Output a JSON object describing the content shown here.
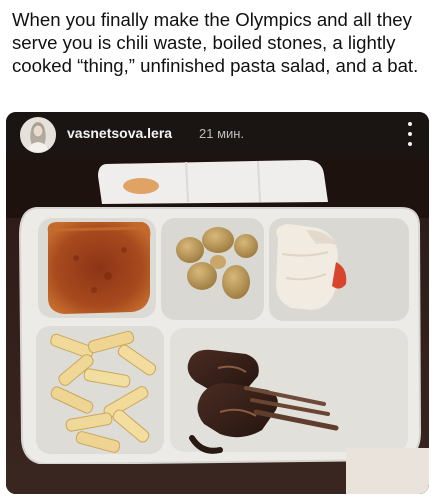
{
  "caption": {
    "text": "When you finally make the Olympics and all they serve you is chili waste, boiled stones, a lightly cooked “thing,” unfinished pasta salad, and a bat."
  },
  "post": {
    "username": "vasnetsova.lera",
    "timestamp": "21 мин.",
    "avatar_icon": "profile-avatar",
    "more_icon": "more-vertical-icon"
  },
  "photo": {
    "compartments": [
      "chili",
      "potatoes",
      "chicken",
      "pasta",
      "meat"
    ]
  },
  "colors": {
    "post_background": "#1a1412",
    "tray": "#ecebe8",
    "text_light": "#f4f4f4"
  }
}
